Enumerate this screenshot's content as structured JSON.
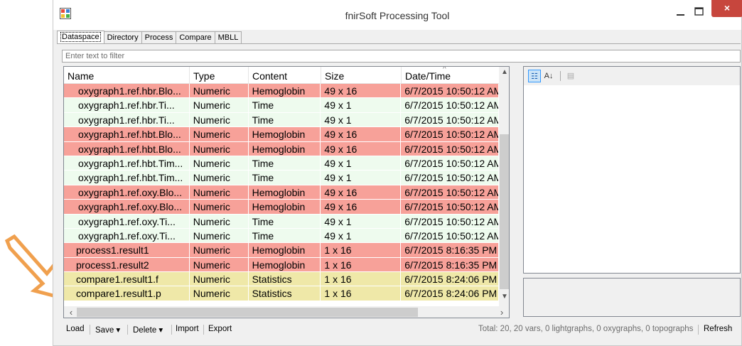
{
  "window": {
    "title": "fnirSoft Processing Tool",
    "close_glyph": "×"
  },
  "tabs": [
    {
      "label": "Dataspace",
      "active": true
    },
    {
      "label": "Directory",
      "active": false
    },
    {
      "label": "Process",
      "active": false
    },
    {
      "label": "Compare",
      "active": false
    },
    {
      "label": "MBLL",
      "active": false
    }
  ],
  "filter": {
    "placeholder": "Enter text to filter"
  },
  "table": {
    "columns": [
      "Name",
      "Type",
      "Content",
      "Size",
      "Date/Time"
    ],
    "sort_column": "Date/Time",
    "rows": [
      {
        "name": "oxygraph1.ref.hbr.Blo...",
        "type": "Numeric",
        "content": "Hemoglobin",
        "size": "49 x 16",
        "date": "6/7/2015 10:50:12 AM",
        "color": "#f7a199"
      },
      {
        "name": "oxygraph1.ref.hbr.Ti...",
        "type": "Numeric",
        "content": "Time",
        "size": "49 x 1",
        "date": "6/7/2015 10:50:12 AM",
        "color": "#eefbee"
      },
      {
        "name": "oxygraph1.ref.hbr.Ti...",
        "type": "Numeric",
        "content": "Time",
        "size": "49 x 1",
        "date": "6/7/2015 10:50:12 AM",
        "color": "#eefbee"
      },
      {
        "name": "oxygraph1.ref.hbt.Blo...",
        "type": "Numeric",
        "content": "Hemoglobin",
        "size": "49 x 16",
        "date": "6/7/2015 10:50:12 AM",
        "color": "#f7a199"
      },
      {
        "name": "oxygraph1.ref.hbt.Blo...",
        "type": "Numeric",
        "content": "Hemoglobin",
        "size": "49 x 16",
        "date": "6/7/2015 10:50:12 AM",
        "color": "#f7a199"
      },
      {
        "name": "oxygraph1.ref.hbt.Tim...",
        "type": "Numeric",
        "content": "Time",
        "size": "49 x 1",
        "date": "6/7/2015 10:50:12 AM",
        "color": "#eefbee"
      },
      {
        "name": "oxygraph1.ref.hbt.Tim...",
        "type": "Numeric",
        "content": "Time",
        "size": "49 x 1",
        "date": "6/7/2015 10:50:12 AM",
        "color": "#eefbee"
      },
      {
        "name": "oxygraph1.ref.oxy.Blo...",
        "type": "Numeric",
        "content": "Hemoglobin",
        "size": "49 x 16",
        "date": "6/7/2015 10:50:12 AM",
        "color": "#f7a199"
      },
      {
        "name": "oxygraph1.ref.oxy.Blo...",
        "type": "Numeric",
        "content": "Hemoglobin",
        "size": "49 x 16",
        "date": "6/7/2015 10:50:12 AM",
        "color": "#f7a199"
      },
      {
        "name": "oxygraph1.ref.oxy.Ti...",
        "type": "Numeric",
        "content": "Time",
        "size": "49 x 1",
        "date": "6/7/2015 10:50:12 AM",
        "color": "#eefbee"
      },
      {
        "name": "oxygraph1.ref.oxy.Ti...",
        "type": "Numeric",
        "content": "Time",
        "size": "49 x 1",
        "date": "6/7/2015 10:50:12 AM",
        "color": "#eefbee"
      },
      {
        "name": "process1.result1",
        "type": "Numeric",
        "content": "Hemoglobin",
        "size": "1 x 16",
        "date": "6/7/2015 8:16:35 PM",
        "color": "#f7a199"
      },
      {
        "name": "process1.result2",
        "type": "Numeric",
        "content": "Hemoglobin",
        "size": "1 x 16",
        "date": "6/7/2015 8:16:35 PM",
        "color": "#f7a199"
      },
      {
        "name": "compare1.result1.f",
        "type": "Numeric",
        "content": "Statistics",
        "size": "1 x 16",
        "date": "6/7/2015 8:24:06 PM",
        "color": "#efe8a8"
      },
      {
        "name": "compare1.result1.p",
        "type": "Numeric",
        "content": "Statistics",
        "size": "1 x 16",
        "date": "6/7/2015 8:24:06 PM",
        "color": "#efe8a8"
      }
    ]
  },
  "property_grid": {
    "tools": [
      "categorized-icon",
      "alphabetical-icon",
      "property-pages-icon"
    ]
  },
  "toolbar": {
    "load": "Load",
    "save": "Save ▾",
    "delete": "Delete ▾",
    "import": "Import",
    "export": "Export",
    "status": "Total: 20, 20 vars, 0 lightgraphs, 0 oxygraphs, 0 topographs",
    "refresh": "Refresh"
  },
  "colors": {
    "arrow": "#f0a04e",
    "hemoglobin_row": "#f7a199",
    "time_row": "#eefbee",
    "statistics_row": "#efe8a8",
    "close_button": "#c7463d"
  }
}
